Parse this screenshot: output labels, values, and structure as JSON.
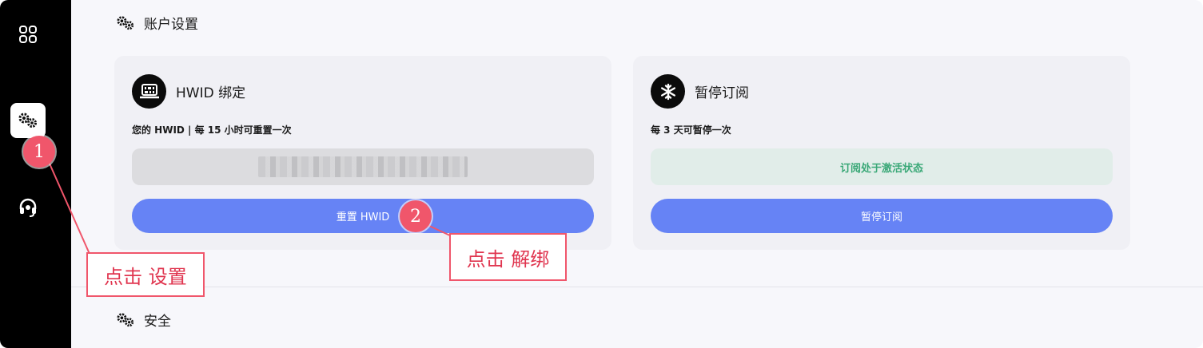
{
  "sidebar": {
    "items": [
      {
        "icon": "grid-icon"
      },
      {
        "icon": "gears-icon",
        "active": true
      },
      {
        "icon": "headset-icon"
      }
    ]
  },
  "account_section": {
    "title": "账户设置",
    "icon": "gears-icon"
  },
  "hwid_card": {
    "title": "HWID 绑定",
    "icon": "laptop-binary-icon",
    "subtitle": "您的 HWID | 每 15 小时可重置一次",
    "hwid_value_state": "blurred",
    "button_label": "重置 HWID"
  },
  "pause_card": {
    "title": "暂停订阅",
    "icon": "snowflake-icon",
    "subtitle": "每 3 天可暂停一次",
    "status_text": "订阅处于激活状态",
    "button_label": "暂停订阅"
  },
  "security_section": {
    "title": "安全",
    "icon": "gears-icon"
  },
  "annotations": {
    "marker1": "1",
    "marker2": "2",
    "callout1": "点击 设置",
    "callout2": "点击 解绑"
  },
  "colors": {
    "accent": "#6683f5",
    "annotation": "#f0566b",
    "status_green": "#3aa877",
    "sidebar_bg": "#000000"
  }
}
